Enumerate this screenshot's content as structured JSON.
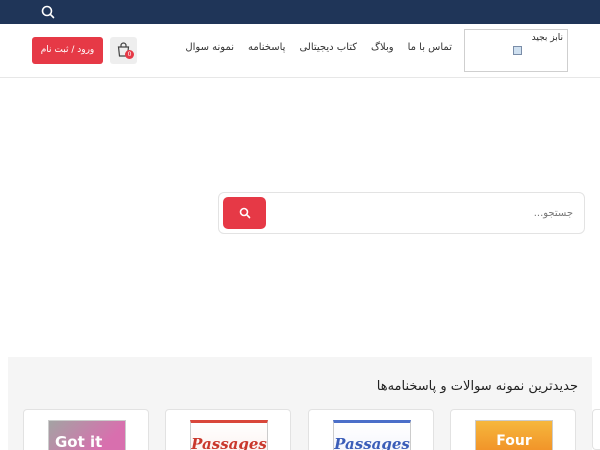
{
  "topbar": {
    "search_icon": "search-icon",
    "background": "#1f3558"
  },
  "header": {
    "login_label": "ورود / ثبت نام",
    "cart_icon": "shopping-bag-icon",
    "cart_count": "0",
    "nav": [
      {
        "label": "نمونه سوال"
      },
      {
        "label": "پاسخنامه"
      },
      {
        "label": "کتاب دیجیتالی"
      },
      {
        "label": "وبلاگ"
      },
      {
        "label": "تماس با ما"
      }
    ],
    "logo_alt": "نابز بجید",
    "accent": "#e63946"
  },
  "search": {
    "placeholder": "جستجو...",
    "value": "",
    "button_icon": "search-icon"
  },
  "latest": {
    "title": "جدیدترین نمونه سوالات و پاسخنامه‌ها",
    "cards": [
      {
        "cover_text": "Four Corners"
      },
      {
        "cover_text": "Passages"
      },
      {
        "cover_text": "Passages"
      },
      {
        "cover_text": "Got it"
      }
    ]
  }
}
